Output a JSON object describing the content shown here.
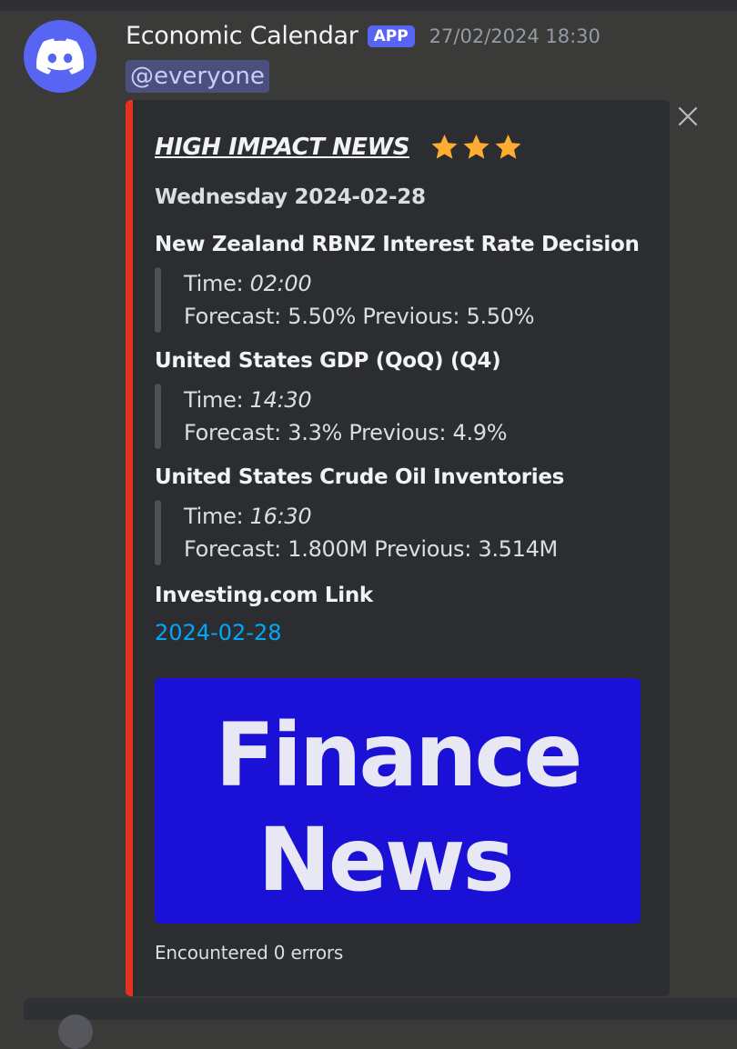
{
  "message": {
    "author": "Economic Calendar",
    "badge": "APP",
    "timestamp": "27/02/2024 18:30",
    "mention": "@everyone"
  },
  "embed": {
    "accent_color": "#e7311f",
    "title": "HIGH IMPACT NEWS",
    "title_stars": 3,
    "day_heading": "Wednesday 2024-02-28",
    "events": [
      {
        "title": "New Zealand RBNZ Interest Rate Decision",
        "time_label": "Time: ",
        "time": "02:00",
        "forecast_line": "Forecast: 5.50% Previous: 5.50%"
      },
      {
        "title": "United States GDP (QoQ)  (Q4)",
        "time_label": "Time: ",
        "time": "14:30",
        "forecast_line": "Forecast: 3.3% Previous: 4.9%"
      },
      {
        "title": "United States Crude Oil Inventories",
        "time_label": "Time: ",
        "time": "16:30",
        "forecast_line": "Forecast: 1.800M Previous: 3.514M"
      }
    ],
    "link_heading": "Investing.com Link",
    "link_text": "2024-02-28",
    "image_text": {
      "line1": "Finance",
      "line2": "News"
    },
    "image_bg": "#1a10d6",
    "footer": "Encountered 0 errors"
  },
  "icons": {
    "avatar": "discord-logo-icon",
    "close": "close-icon",
    "star": "star-icon"
  }
}
